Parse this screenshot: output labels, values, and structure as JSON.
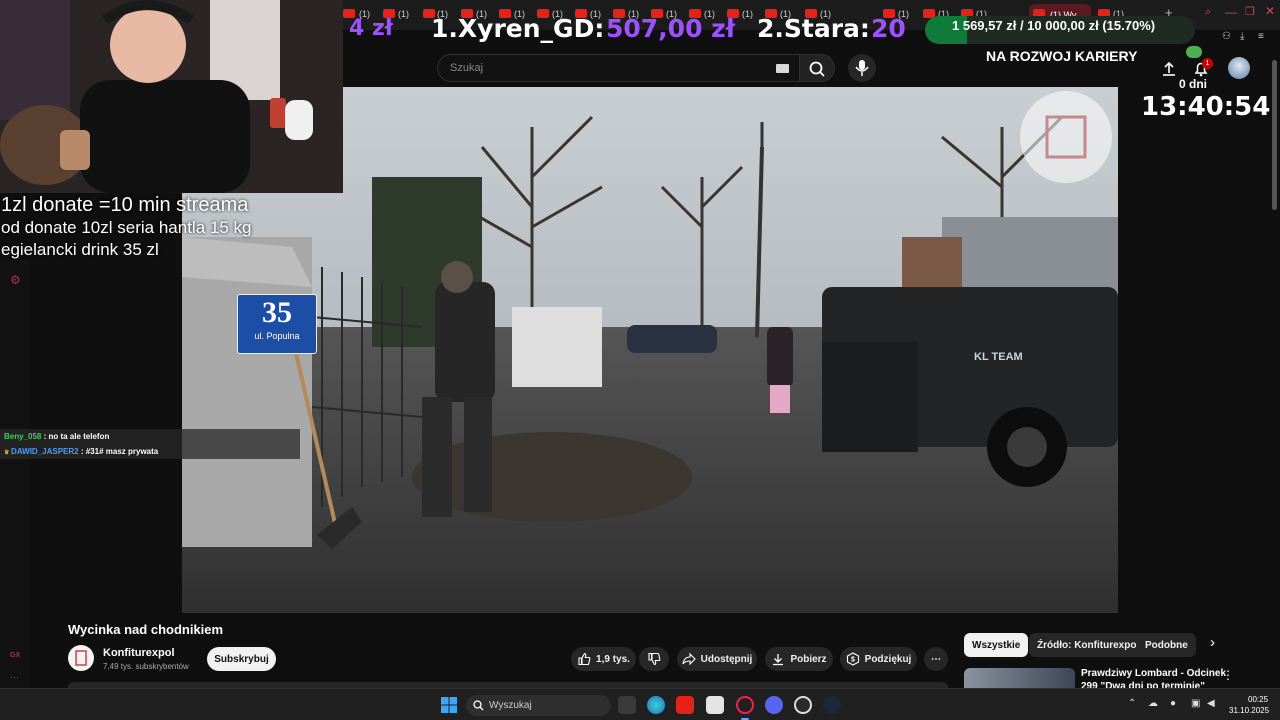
{
  "ticker": {
    "left_amount": "4 zł",
    "first_place": "1.Xyren_GD:",
    "first_amount": "507,00 zł",
    "second_place": "2.Stara:",
    "second_amount": "20"
  },
  "goal": {
    "text": "1 569,57 zł / 10 000,00 zł (15.70%)",
    "progress_fraction": 0.157,
    "title": "NA ROZWOJ KARIERY",
    "days": "0 dni",
    "timer": "13:40:54",
    "notification_count": "1"
  },
  "browser": {
    "active_tab": "(1) Wy",
    "tab_badge": "(1)"
  },
  "search": {
    "placeholder": "Szukaj"
  },
  "overlay": {
    "line1": "1zl donate =10 min streama",
    "line2": "od donate 10zl seria hantla 15 kg",
    "line3": "egielancki drink 35 zl"
  },
  "chat": [
    {
      "user": "Beny_058",
      "sep": " : ",
      "text": "no ta ale telefon",
      "user_color": "#3ccf5a"
    },
    {
      "user": "DAWID_JASPER2",
      "sep": " : ",
      "text": "#31# masz prywata",
      "user_color": "#4a9ff5"
    }
  ],
  "video": {
    "sign_number": "35",
    "sign_street": "ul. Populna",
    "truck_text": "KL TEAM"
  },
  "watch": {
    "title": "Wycinka nad chodnikiem",
    "channel_name": "Konfiturexpol",
    "subscribers": "7,49 tys. subskrybentów",
    "subscribe_label": "Subskrybuj",
    "likes": "1,9 tys.",
    "share_label": "Udostępnij",
    "download_label": "Pobierz",
    "thanks_label": "Podziękuj",
    "more_label": "⋯"
  },
  "side": {
    "chips": [
      "Wszystkie",
      "Źródło: Konfiturexpol",
      "Podobne"
    ],
    "rec_title_line1": "Prawdziwy Lombard - Odcinek",
    "rec_title_line2": "299 \"Dwa dni po terminie\""
  },
  "stream_panel": {
    "gx_label": "GX"
  },
  "taskbar": {
    "search_placeholder": "Wyszukaj",
    "time": "00:25",
    "date": "31.10.2025"
  },
  "colors": {
    "accent_purple": "#9c52ff",
    "yt_red": "#e62117",
    "goal_green": "#0f7a3a"
  }
}
